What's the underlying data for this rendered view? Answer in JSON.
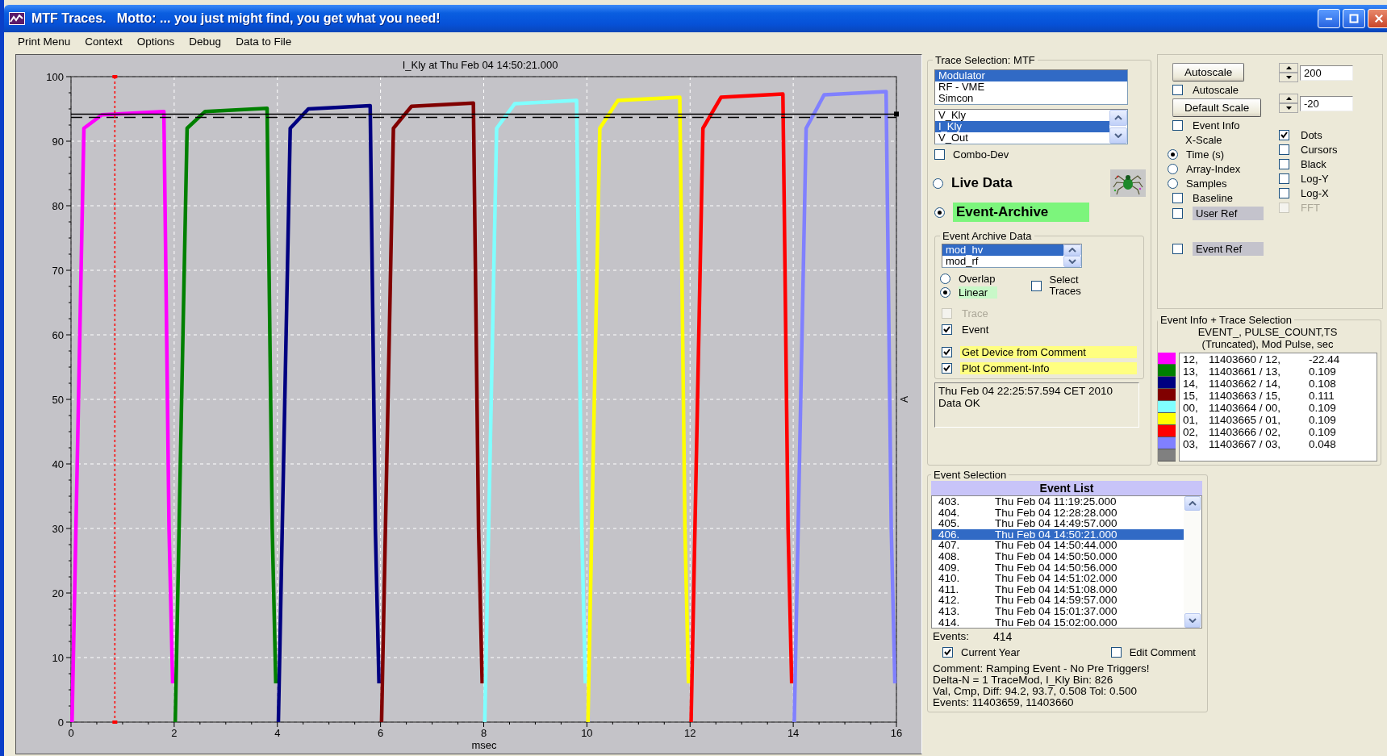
{
  "window": {
    "title": "MTF Traces.   Motto: ... you just might find, you get what you need!"
  },
  "menu": [
    "Print Menu",
    "Context",
    "Options",
    "Debug",
    "Data to File"
  ],
  "plot": {
    "chart_data": {
      "type": "line",
      "title": "I_Kly   at   Thu Feb 04 14:50:21.000",
      "xlabel": "msec",
      "ylabel": "A",
      "x": [
        0.02,
        0.12,
        0.25,
        0.6,
        1.8,
        1.9,
        1.97,
        2.02,
        2.12,
        2.25,
        2.6,
        3.8,
        3.9,
        3.97,
        4.02,
        4.12,
        4.25,
        4.6,
        5.8,
        5.9,
        5.97,
        6.02,
        6.12,
        6.25,
        6.6,
        7.8,
        7.9,
        7.97,
        8.02,
        8.12,
        8.25,
        8.6,
        9.8,
        9.9,
        9.97,
        10.02,
        10.12,
        10.25,
        10.6,
        11.8,
        11.9,
        11.97,
        12.02,
        12.12,
        12.25,
        12.6,
        13.8,
        13.9,
        13.97,
        14.02,
        14.12,
        14.25,
        14.6,
        15.8,
        15.9,
        15.97
      ],
      "series": [
        {
          "color": "#ff00ff",
          "values": [
            0,
            40,
            92,
            94.1,
            94.6,
            30,
            6,
            null,
            null,
            null,
            null,
            null,
            null,
            null,
            null,
            null,
            null,
            null,
            null,
            null,
            null,
            null,
            null,
            null,
            null,
            null,
            null,
            null,
            null,
            null,
            null,
            null,
            null,
            null,
            null,
            null,
            null,
            null,
            null,
            null,
            null,
            null,
            null,
            null,
            null,
            null,
            null,
            null,
            null,
            null,
            null,
            null,
            null,
            null,
            null,
            null
          ]
        },
        {
          "color": "#008000",
          "values": [
            null,
            null,
            null,
            null,
            null,
            null,
            null,
            0,
            40,
            92,
            94.6,
            95.1,
            30,
            6,
            null,
            null,
            null,
            null,
            null,
            null,
            null,
            null,
            null,
            null,
            null,
            null,
            null,
            null,
            null,
            null,
            null,
            null,
            null,
            null,
            null,
            null,
            null,
            null,
            null,
            null,
            null,
            null,
            null,
            null,
            null,
            null,
            null,
            null,
            null,
            null,
            null,
            null,
            null,
            null,
            null,
            null
          ]
        },
        {
          "color": "#000080",
          "values": [
            null,
            null,
            null,
            null,
            null,
            null,
            null,
            null,
            null,
            null,
            null,
            null,
            null,
            null,
            0,
            40,
            92,
            95.0,
            95.5,
            30,
            6,
            null,
            null,
            null,
            null,
            null,
            null,
            null,
            null,
            null,
            null,
            null,
            null,
            null,
            null,
            null,
            null,
            null,
            null,
            null,
            null,
            null,
            null,
            null,
            null,
            null,
            null,
            null,
            null,
            null,
            null,
            null,
            null,
            null,
            null,
            null
          ]
        },
        {
          "color": "#800000",
          "values": [
            null,
            null,
            null,
            null,
            null,
            null,
            null,
            null,
            null,
            null,
            null,
            null,
            null,
            null,
            null,
            null,
            null,
            null,
            null,
            null,
            null,
            0,
            40,
            92,
            95.4,
            95.9,
            30,
            6,
            null,
            null,
            null,
            null,
            null,
            null,
            null,
            null,
            null,
            null,
            null,
            null,
            null,
            null,
            null,
            null,
            null,
            null,
            null,
            null,
            null,
            null,
            null,
            null,
            null,
            null,
            null,
            null
          ]
        },
        {
          "color": "#80ffff",
          "values": [
            null,
            null,
            null,
            null,
            null,
            null,
            null,
            null,
            null,
            null,
            null,
            null,
            null,
            null,
            null,
            null,
            null,
            null,
            null,
            null,
            null,
            null,
            null,
            null,
            null,
            null,
            null,
            null,
            0,
            40,
            92,
            95.8,
            96.3,
            30,
            6,
            null,
            null,
            null,
            null,
            null,
            null,
            null,
            null,
            null,
            null,
            null,
            null,
            null,
            null,
            null,
            null,
            null,
            null,
            null,
            null,
            null
          ]
        },
        {
          "color": "#ffff00",
          "values": [
            null,
            null,
            null,
            null,
            null,
            null,
            null,
            null,
            null,
            null,
            null,
            null,
            null,
            null,
            null,
            null,
            null,
            null,
            null,
            null,
            null,
            null,
            null,
            null,
            null,
            null,
            null,
            null,
            null,
            null,
            null,
            null,
            null,
            null,
            null,
            0,
            40,
            92,
            96.3,
            96.8,
            30,
            6,
            null,
            null,
            null,
            null,
            null,
            null,
            null,
            null,
            null,
            null,
            null,
            null,
            null,
            null
          ]
        },
        {
          "color": "#ff0000",
          "values": [
            null,
            null,
            null,
            null,
            null,
            null,
            null,
            null,
            null,
            null,
            null,
            null,
            null,
            null,
            null,
            null,
            null,
            null,
            null,
            null,
            null,
            null,
            null,
            null,
            null,
            null,
            null,
            null,
            null,
            null,
            null,
            null,
            null,
            null,
            null,
            null,
            null,
            null,
            null,
            null,
            null,
            null,
            0,
            40,
            92,
            96.8,
            97.3,
            30,
            6,
            null,
            null,
            null,
            null,
            null,
            null,
            null
          ]
        },
        {
          "color": "#8080ff",
          "values": [
            null,
            null,
            null,
            null,
            null,
            null,
            null,
            null,
            null,
            null,
            null,
            null,
            null,
            null,
            null,
            null,
            null,
            null,
            null,
            null,
            null,
            null,
            null,
            null,
            null,
            null,
            null,
            null,
            null,
            null,
            null,
            null,
            null,
            null,
            null,
            null,
            null,
            null,
            null,
            null,
            null,
            null,
            null,
            null,
            null,
            null,
            null,
            null,
            null,
            0,
            40,
            92,
            97.2,
            97.7,
            30,
            6
          ]
        }
      ],
      "xlim": [
        0,
        16
      ],
      "ylim": [
        0,
        100
      ],
      "xticks": [
        0,
        2,
        4,
        6,
        8,
        10,
        12,
        14,
        16
      ],
      "yticks": [
        0,
        10,
        20,
        30,
        40,
        50,
        60,
        70,
        80,
        90,
        100
      ],
      "grid": true,
      "ref_lines": [
        {
          "axis": "y",
          "value": 94.2
        },
        {
          "axis": "y",
          "value": 93.7
        },
        {
          "axis": "x",
          "value": 0.85
        }
      ]
    }
  },
  "trace_selection": {
    "title": "Trace Selection: MTF",
    "systems": [
      {
        "label": "Modulator",
        "selected": true
      },
      {
        "label": "RF - VME",
        "selected": false
      },
      {
        "label": "Simcon",
        "selected": false
      }
    ],
    "signals": [
      {
        "label": "V_Kly",
        "selected": false
      },
      {
        "label": "I_Kly",
        "selected": true
      },
      {
        "label": "V_Out",
        "selected": false
      }
    ],
    "combo_dev": {
      "label": "Combo-Dev",
      "checked": false
    },
    "sources": [
      {
        "label": "Live Data",
        "selected": false,
        "highlighted": false
      },
      {
        "label": "Event-Archive",
        "selected": true,
        "highlighted": true
      }
    ],
    "archive": {
      "title": "Event Archive Data",
      "lists": [
        {
          "label": "mod_hv",
          "selected": true
        },
        {
          "label": "mod_rf",
          "selected": false
        }
      ],
      "modes": [
        {
          "label": "Overlap",
          "selected": false,
          "highlighted": false
        },
        {
          "label": "Linear",
          "selected": true,
          "highlighted": true
        }
      ],
      "select_traces": {
        "label": "Select Traces",
        "checked": false
      },
      "options": [
        {
          "label": "Trace",
          "checked": false,
          "disabled": true,
          "highlighted": false
        },
        {
          "label": "Event",
          "checked": true,
          "disabled": false,
          "highlighted": false
        },
        {
          "label": "Get Device from Comment",
          "checked": true,
          "disabled": false,
          "highlighted": true
        },
        {
          "label": "Plot Comment-Info",
          "checked": true,
          "disabled": false,
          "highlighted": true
        }
      ]
    },
    "status": "Thu Feb 04 22:25:57.594 CET 2010  Data OK"
  },
  "scale_panel": {
    "left": [
      {
        "kind": "button",
        "label": "Autoscale"
      },
      {
        "kind": "checkbox",
        "label": "Autoscale",
        "checked": false,
        "highlighted": false
      },
      {
        "kind": "button",
        "label": "Default Scale"
      },
      {
        "kind": "checkbox",
        "label": "Event Info",
        "checked": false,
        "highlighted": false
      },
      {
        "kind": "heading",
        "label": "X-Scale"
      },
      {
        "kind": "radio",
        "label": "Time (s)",
        "selected": true
      },
      {
        "kind": "radio",
        "label": "Array-Index",
        "selected": false
      },
      {
        "kind": "radio",
        "label": "Samples",
        "selected": false
      },
      {
        "kind": "checkbox",
        "label": "Baseline",
        "checked": false,
        "highlighted": false
      },
      {
        "kind": "checkbox",
        "label": "User Ref",
        "checked": false,
        "highlighted": true
      },
      {
        "kind": "checkbox",
        "label": "Event Ref",
        "checked": false,
        "highlighted": true
      }
    ],
    "spinners": [
      {
        "value": "200"
      },
      {
        "value": "-20"
      }
    ],
    "right": [
      {
        "label": "Dots",
        "checked": true,
        "disabled": false
      },
      {
        "label": "Cursors",
        "checked": false,
        "disabled": false
      },
      {
        "label": "Black",
        "checked": false,
        "disabled": false
      },
      {
        "label": "Log-Y",
        "checked": false,
        "disabled": false
      },
      {
        "label": "Log-X",
        "checked": false,
        "disabled": false
      },
      {
        "label": "FFT",
        "checked": false,
        "disabled": true
      }
    ]
  },
  "event_info": {
    "title": "Event Info   +   Trace Selection",
    "headers": [
      "EVENT_,  PULSE_COUNT,TS",
      "(Truncated),   Mod Pulse,     sec"
    ],
    "rows": [
      {
        "color": "#ff00ff",
        "event": "12,",
        "pulse": "11403660 / 12,",
        "ts": "-22.44"
      },
      {
        "color": "#008000",
        "event": "13,",
        "pulse": "11403661 / 13,",
        "ts": "0.109"
      },
      {
        "color": "#000080",
        "event": "14,",
        "pulse": "11403662 / 14,",
        "ts": "0.108"
      },
      {
        "color": "#800000",
        "event": "15,",
        "pulse": "11403663 / 15,",
        "ts": "0.111"
      },
      {
        "color": "#80ffff",
        "event": "00,",
        "pulse": "11403664 / 00,",
        "ts": "0.109"
      },
      {
        "color": "#ffff00",
        "event": "01,",
        "pulse": "11403665 / 01,",
        "ts": "0.109"
      },
      {
        "color": "#ff0000",
        "event": "02,",
        "pulse": "11403666 / 02,",
        "ts": "0.109"
      },
      {
        "color": "#8080ff",
        "event": "03,",
        "pulse": "11403667 / 03,",
        "ts": "0.048"
      },
      {
        "color": "#808080"
      }
    ]
  },
  "event_selection": {
    "title": "Event Selection",
    "list_title": "Event List",
    "events": [
      {
        "index": "403.",
        "time": "Thu Feb 04 11:19:25.000",
        "selected": false
      },
      {
        "index": "404.",
        "time": "Thu Feb 04 12:28:28.000",
        "selected": false
      },
      {
        "index": "405.",
        "time": "Thu Feb 04 14:49:57.000",
        "selected": false
      },
      {
        "index": "406.",
        "time": "Thu Feb 04 14:50:21.000",
        "selected": true
      },
      {
        "index": "407.",
        "time": "Thu Feb 04 14:50:44.000",
        "selected": false
      },
      {
        "index": "408.",
        "time": "Thu Feb 04 14:50:50.000",
        "selected": false
      },
      {
        "index": "409.",
        "time": "Thu Feb 04 14:50:56.000",
        "selected": false
      },
      {
        "index": "410.",
        "time": "Thu Feb 04 14:51:02.000",
        "selected": false
      },
      {
        "index": "411.",
        "time": "Thu Feb 04 14:51:08.000",
        "selected": false
      },
      {
        "index": "412.",
        "time": "Thu Feb 04 14:59:57.000",
        "selected": false
      },
      {
        "index": "413.",
        "time": "Thu Feb 04 15:01:37.000",
        "selected": false
      },
      {
        "index": "414.",
        "time": "Thu Feb 04 15:02:00.000",
        "selected": false
      }
    ],
    "count_label": "Events:",
    "count": "414",
    "current_year": {
      "label": "Current Year",
      "checked": true
    },
    "edit_comment": {
      "label": "Edit Comment",
      "checked": false
    },
    "comment_lines": [
      "Comment: Ramping Event - No Pre Triggers!",
      "Delta-N =  1 TraceMod, I_Kly  Bin:  826",
      "Val, Cmp, Diff: 94.2, 93.7, 0.508 Tol: 0.500",
      "Events:  11403659,  11403660"
    ]
  }
}
